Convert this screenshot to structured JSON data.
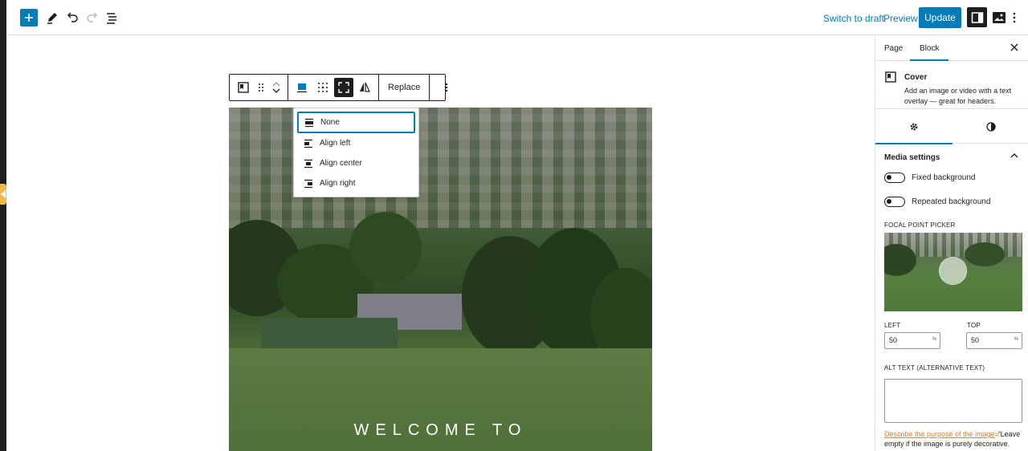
{
  "topbar": {
    "switch_to_draft": "Switch to draft",
    "preview": "Preview",
    "update": "Update",
    "icons": [
      "plus-icon",
      "pencil-icon",
      "undo-icon",
      "redo-icon",
      "list-view-icon",
      "sidebar-icon",
      "image-icon",
      "more-vertical-icon"
    ]
  },
  "block_toolbar": {
    "replace_label": "Replace"
  },
  "align_menu": {
    "items": [
      {
        "label": "None",
        "selected": true
      },
      {
        "label": "Align left",
        "selected": false
      },
      {
        "label": "Align center",
        "selected": false
      },
      {
        "label": "Align right",
        "selected": false
      }
    ]
  },
  "cover": {
    "heading": "WELCOME TO"
  },
  "sidebar": {
    "tabs": [
      {
        "label": "Page",
        "active": false
      },
      {
        "label": "Block",
        "active": true
      }
    ],
    "block": {
      "title": "Cover",
      "description": "Add an image or video with a text overlay — great for headers."
    },
    "media_settings": {
      "title": "Media settings",
      "fixed_background": "Fixed background",
      "repeated_background": "Repeated background",
      "focal_point_label": "FOCAL POINT PICKER",
      "left_label": "LEFT",
      "top_label": "TOP",
      "left_value": "50",
      "top_value": "50",
      "unit": "%",
      "alt_label": "ALT TEXT (ALTERNATIVE TEXT)",
      "alt_link": "Describe the purpose of the image",
      "alt_help": "Leave empty if the image is purely decorative."
    }
  },
  "colors": {
    "accent": "#007cba",
    "dark": "#1e1e1e",
    "warning_tab": "#f0b849"
  }
}
